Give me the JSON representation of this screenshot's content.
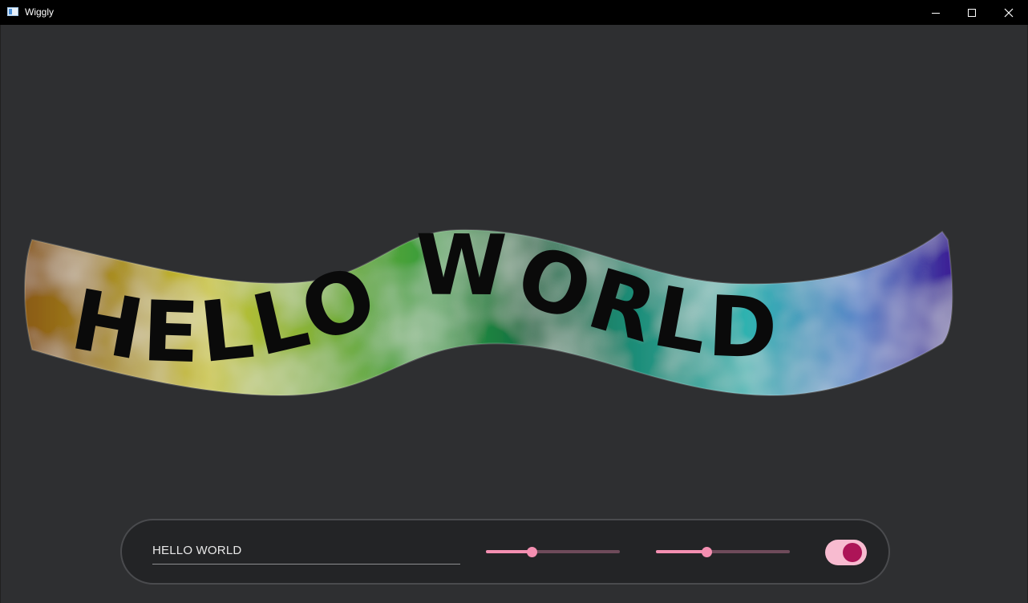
{
  "window": {
    "title": "Wiggly",
    "app_icon": "app-window-icon",
    "controls": [
      "minimize-icon",
      "maximize-icon",
      "close-icon"
    ]
  },
  "banner": {
    "text": "HELLO WORLD",
    "gradient_colors": [
      "#8a5a12",
      "#c9c436",
      "#2f9a3a",
      "#0f6b45",
      "#2fb2b0",
      "#5a86c8",
      "#3b1f95"
    ]
  },
  "controls": {
    "text_input": {
      "value": "HELLO WORLD"
    },
    "slider_1": {
      "value": 0.34,
      "accent": "#f48fb1",
      "track": "#6e4b5a"
    },
    "slider_2": {
      "value": 0.38,
      "accent": "#f48fb1",
      "track": "#6e4b5a"
    },
    "toggle": {
      "checked": true,
      "track": "#f8bbd0",
      "thumb": "#ad1457"
    }
  },
  "colors": {
    "background": "#2e2f31",
    "panel": "#232426",
    "titlebar": "#000000"
  }
}
